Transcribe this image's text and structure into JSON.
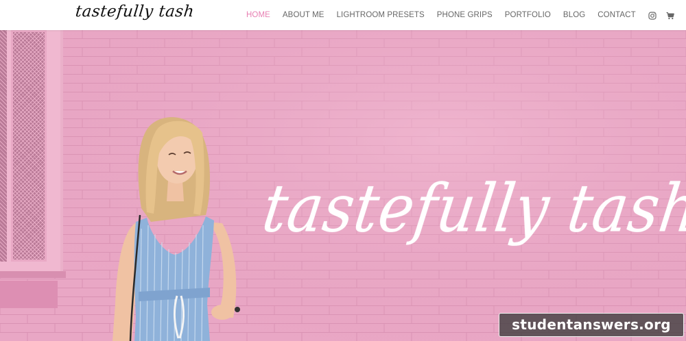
{
  "header": {
    "logo_text": "tastefully tash",
    "nav": [
      {
        "label": "HOME",
        "active": true
      },
      {
        "label": "ABOUT ME",
        "active": false
      },
      {
        "label": "LIGHTROOM PRESETS",
        "active": false
      },
      {
        "label": "PHONE GRIPS",
        "active": false
      },
      {
        "label": "PORTFOLIO",
        "active": false
      },
      {
        "label": "BLOG",
        "active": false
      },
      {
        "label": "CONTACT",
        "active": false
      }
    ],
    "icons": [
      "instagram-icon",
      "shopping-cart-icon"
    ]
  },
  "hero": {
    "script_text": "tastefully tash"
  },
  "watermark": {
    "text": "studentanswers.org"
  },
  "colors": {
    "accent": "#e77fb2",
    "wall_pink": "#e8a6c4",
    "nav_text": "#666666",
    "dress_blue": "#8fb2da"
  }
}
